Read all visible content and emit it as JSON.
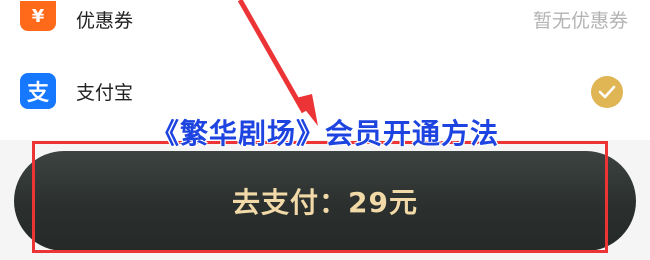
{
  "coupon_row": {
    "label": "优惠券",
    "value": "暂无优惠券",
    "icon": "coupon-icon"
  },
  "payment_row": {
    "label": "支付宝",
    "icon": "alipay-icon",
    "selected": true
  },
  "pay_button": {
    "label": "去支付：29元"
  },
  "overlay": {
    "caption": "《繁华剧场》会员开通方法"
  },
  "colors": {
    "accent": "#e0b554",
    "alipay": "#1677ff",
    "coupon": "#ff6a1a",
    "annotation": "#ec3437",
    "caption": "#1d44e0"
  }
}
